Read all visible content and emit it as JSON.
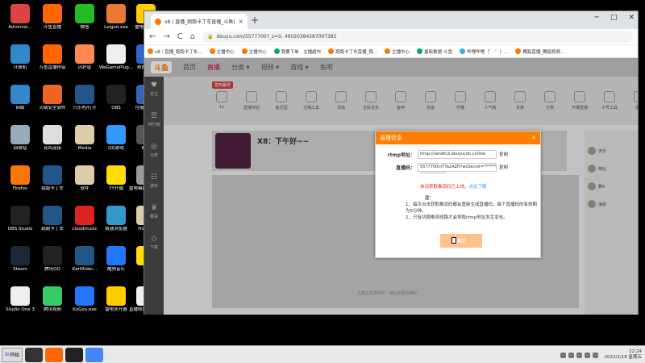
{
  "desktop": {
    "icons": [
      {
        "label": "Administ...",
        "color": "#d44"
      },
      {
        "label": "斗鱼直播",
        "color": "#f60"
      },
      {
        "label": "微信",
        "color": "#2b2"
      },
      {
        "label": "Leigod.exe",
        "color": "#e73"
      },
      {
        "label": "雷电模拟器",
        "color": "#fc0"
      },
      {
        "label": "计算机",
        "color": "#38c"
      },
      {
        "label": "斗鱼直播伴侣",
        "color": "#f60"
      },
      {
        "label": "闪扑兽",
        "color": "#f85"
      },
      {
        "label": "WeGamePlug...",
        "color": "#eee"
      },
      {
        "label": "奇妙加速",
        "color": "#36c"
      },
      {
        "label": "网络",
        "color": "#38c"
      },
      {
        "label": "火绒安全软件",
        "color": "#e62"
      },
      {
        "label": "只乐吧/打开",
        "color": "#258"
      },
      {
        "label": "OBS",
        "color": "#222"
      },
      {
        "label": "月报打开器",
        "color": "#36b"
      },
      {
        "label": "回收站",
        "color": "#9ab"
      },
      {
        "label": "亮风连接",
        "color": "#ddd"
      },
      {
        "label": "Media",
        "color": "#dca"
      },
      {
        "label": "QQ游戏",
        "color": "#39f"
      },
      {
        "label": "账号",
        "color": "#555"
      },
      {
        "label": "Firefox",
        "color": "#f70"
      },
      {
        "label": "跑跑卡丁车",
        "color": "#258"
      },
      {
        "label": "软件",
        "color": "#dca"
      },
      {
        "label": "YY开播",
        "color": "#fd0"
      },
      {
        "label": "雷电模拟器songli",
        "color": "#999"
      },
      {
        "label": "OBS Studio",
        "color": "#222"
      },
      {
        "label": "跑跑卡丁车",
        "color": "#258"
      },
      {
        "label": "cloudmusic",
        "color": "#d22"
      },
      {
        "label": "极速浏览器",
        "color": "#39c"
      },
      {
        "label": "History",
        "color": "#dca"
      },
      {
        "label": "Steam",
        "color": "#1b2838"
      },
      {
        "label": "腾讯QQ",
        "color": "#222"
      },
      {
        "label": "KartRider...",
        "color": "#258"
      },
      {
        "label": "酷狗音乐",
        "color": "#27f"
      },
      {
        "label": "YY",
        "color": "#fd0"
      },
      {
        "label": "Studio One 3",
        "color": "#eee"
      },
      {
        "label": "腾讯视频",
        "color": "#3c6"
      },
      {
        "label": "KuGou.exe",
        "color": "#27f"
      },
      {
        "label": "雷电多开器",
        "color": "#fc0"
      },
      {
        "label": "直播效果song.auto...",
        "color": "#eee"
      }
    ]
  },
  "browser": {
    "tab_title": "x8 / 直播_跑跑卡丁车直播_斗鱼直播...",
    "tab_close": "×",
    "new_tab": "+",
    "url": "douyu.com/5577700?_z=0, 4902038458700T385",
    "window_controls": [
      "─",
      "□",
      "✕"
    ],
    "nav": {
      "back": "←",
      "forward": "→",
      "reload": "C",
      "home": "⌂"
    },
    "bookmarks": [
      {
        "label": "x8 / 直播_跑跑卡丁车...",
        "color": "#f70"
      },
      {
        "label": "主播中心",
        "color": "#f70"
      },
      {
        "label": "主播中心",
        "color": "#f70"
      },
      {
        "label": "我要下单 - 主播超市",
        "color": "#0a6"
      },
      {
        "label": "跑跑卡丁车直播_跑...",
        "color": "#f70"
      },
      {
        "label": "主播中心",
        "color": "#f70"
      },
      {
        "label": "最新数据-斗鱼",
        "color": "#0a6"
      },
      {
        "label": "哔哩哔哩（゜-゜）...",
        "color": "#3af"
      },
      {
        "label": "舞蹈直播_舞蹈视频...",
        "color": "#f70"
      }
    ]
  },
  "site": {
    "logo": "斗鱼",
    "nav": [
      {
        "label": "首页",
        "active": false
      },
      {
        "label": "直播",
        "active": true
      },
      {
        "label": "分类 ▾",
        "active": false
      },
      {
        "label": "视频 ▾",
        "active": false
      },
      {
        "label": "游戏 ▾",
        "active": false
      },
      {
        "label": "鱼吧",
        "active": false
      }
    ],
    "left_sidebar": [
      {
        "icon": "♥",
        "label": "关注"
      },
      {
        "icon": "☰",
        "label": "排行榜"
      },
      {
        "icon": "◎",
        "label": "分类"
      },
      {
        "icon": "☷",
        "label": "游戏"
      },
      {
        "icon": "♛",
        "label": "赛事"
      },
      {
        "icon": "◇",
        "label": "下载"
      }
    ],
    "badge_text": "签到赢奖",
    "categories": [
      "11",
      "直播伴侣",
      "鱼乐园",
      "主播工具",
      "活动",
      "全民任务",
      "鱼吧",
      "充值",
      "开播",
      "人气榜",
      "贵族",
      "分类",
      "开播直播",
      "小号工具",
      "更多"
    ],
    "room_title": "X8：下午好~~",
    "video_text": "主播正在游戏中 · 稍后会更加精彩"
  },
  "dialog": {
    "title": "直播信息",
    "close": "✕",
    "rtmp_label": "rtmp地址：",
    "rtmp_value": "rtmp://sendtc3.douyucdn.cn/live",
    "code_label": "直播码：",
    "code_value": "5577700rnTYa2AZH?wsSecret=*********",
    "masked_hint": "*************",
    "copy_label": "复制",
    "hint_text": "自动获取推流码已上线，",
    "hint_link": "点此了解",
    "notes_heading": "注：",
    "notes": [
      "1、每次点击获取推流码都会重新生成直播码，每个直播码的有效期为5分钟。",
      "2、只有切换推流线路才会导致rtmp地址发生变化。"
    ],
    "ok_label": "确定"
  },
  "chat": {
    "rows": [
      "天乐",
      "阿比",
      "腾X",
      "海叔"
    ]
  },
  "taskbar": {
    "start_label": "开始",
    "apps": [
      {
        "name": "studio-one-app",
        "color": "#333"
      },
      {
        "name": "douyu-app",
        "color": "#f60"
      },
      {
        "name": "obs-app",
        "color": "#222"
      },
      {
        "name": "chrome-app",
        "color": "#4285f4"
      }
    ],
    "clock_time": "22:24",
    "clock_date": "2022/2/18 星期五"
  }
}
